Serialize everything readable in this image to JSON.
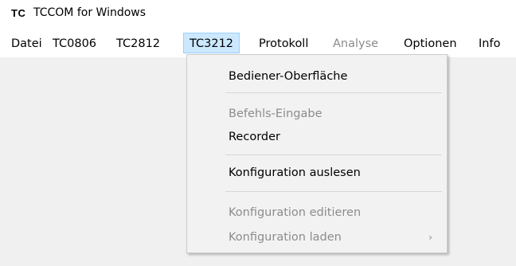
{
  "window": {
    "icon_label": "TC",
    "title": "TCCOM for Windows"
  },
  "menubar": {
    "items": [
      {
        "label": "Datei",
        "enabled": true
      },
      {
        "label": "TC0806",
        "enabled": true
      },
      {
        "label": "TC2812",
        "enabled": true
      },
      {
        "label": "TC3212",
        "enabled": true,
        "open": true
      },
      {
        "label": "Protokoll",
        "enabled": true
      },
      {
        "label": "Analyse",
        "enabled": false
      },
      {
        "label": "Optionen",
        "enabled": true
      },
      {
        "label": "Info",
        "enabled": true
      }
    ]
  },
  "dropdown": {
    "items": [
      {
        "label": "Bediener-Oberfläche",
        "enabled": true
      },
      {
        "label": "Befehls-Eingabe",
        "enabled": false
      },
      {
        "label": "Recorder",
        "enabled": true
      },
      {
        "label": "Konfiguration auslesen",
        "enabled": true
      },
      {
        "label": "Konfiguration editieren",
        "enabled": false
      },
      {
        "label": "Konfiguration laden",
        "enabled": false,
        "submenu_arrow": "›"
      }
    ]
  },
  "colors": {
    "active_menu_bg": "#cce8ff",
    "active_menu_border": "#99d1ff",
    "disabled_text": "#8c8c8c",
    "client_bg": "#f0f0f0",
    "dropdown_bg": "#f2f2f2"
  }
}
